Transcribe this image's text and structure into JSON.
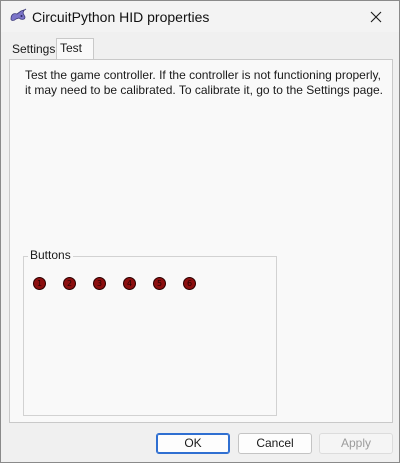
{
  "window": {
    "title": "CircuitPython HID properties",
    "app_icon": "gamepad-icon",
    "close_glyph": "✕"
  },
  "tabs": [
    {
      "label": "Settings",
      "selected": false
    },
    {
      "label": "Test",
      "selected": true
    }
  ],
  "instructions": "Test the game controller.  If the controller is not functioning properly, it may need to be calibrated.  To calibrate it, go to the Settings page.",
  "buttons_group": {
    "label": "Buttons",
    "items": [
      {
        "number": "1",
        "pressed": false
      },
      {
        "number": "2",
        "pressed": false
      },
      {
        "number": "3",
        "pressed": false
      },
      {
        "number": "4",
        "pressed": false
      },
      {
        "number": "5",
        "pressed": false
      },
      {
        "number": "6",
        "pressed": false
      }
    ],
    "color": "#8c0f0f"
  },
  "footer": {
    "ok_label": "OK",
    "cancel_label": "Cancel",
    "apply_label": "Apply"
  },
  "colors": {
    "accent": "#2f6fd1",
    "disabled_text": "#9c9c9c"
  }
}
